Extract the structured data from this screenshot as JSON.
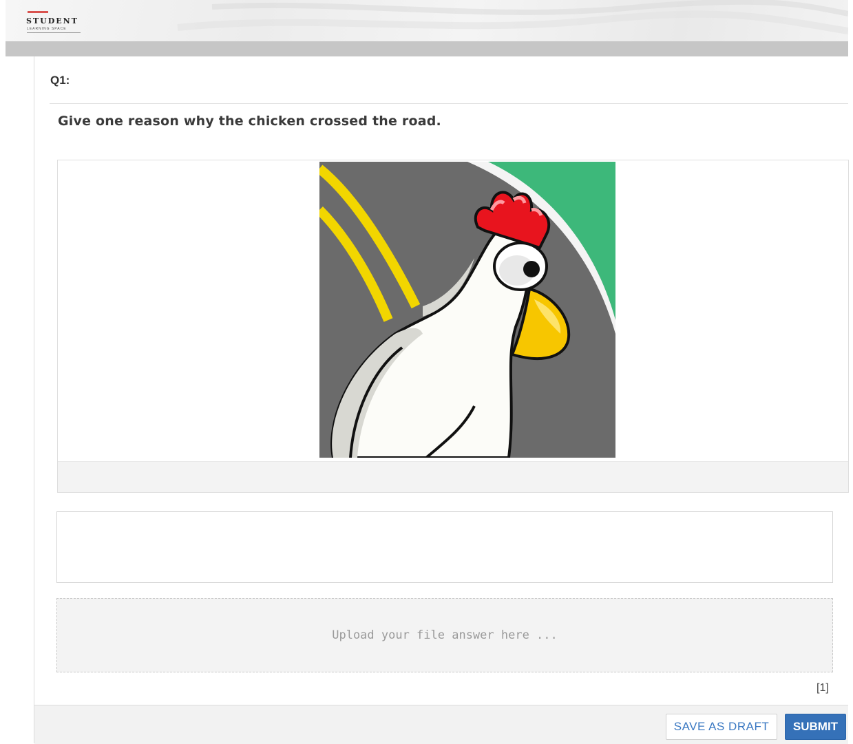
{
  "header": {
    "logo_name": "STUDENT",
    "logo_sub": "LEARNING SPACE"
  },
  "question": {
    "number": "Q1:",
    "text": "Give one reason why the chicken crossed the road.",
    "marks": "[1]"
  },
  "answer": {
    "value": "",
    "upload_placeholder": "Upload your file answer here ..."
  },
  "footer": {
    "save_draft_label": "SAVE AS DRAFT",
    "submit_label": "SUBMIT"
  },
  "colors": {
    "accent": "#3571b8",
    "logo_bar": "#d9534f",
    "road": "#6b6b6b",
    "grass": "#3db87a",
    "road_line": "#f2d600",
    "comb": "#e8141e",
    "beak": "#f7c600"
  },
  "icons": {
    "illustration": "chicken-illustration"
  }
}
